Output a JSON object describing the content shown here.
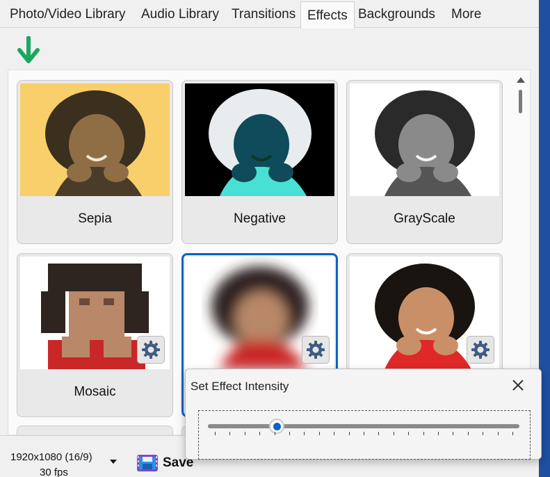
{
  "tabs": [
    {
      "label": "Photo/Video Library",
      "active": false
    },
    {
      "label": "Audio Library",
      "active": false
    },
    {
      "label": "Transitions",
      "active": false
    },
    {
      "label": "Effects",
      "active": true
    },
    {
      "label": "Backgrounds",
      "active": false
    },
    {
      "label": "More",
      "active": false
    }
  ],
  "toolbar": {
    "download_icon": "arrow-down-icon",
    "accent": "#1aa860"
  },
  "effects": [
    {
      "label": "Sepia",
      "style": "sepia",
      "has_settings": false,
      "selected": false
    },
    {
      "label": "Negative",
      "style": "negative",
      "has_settings": false,
      "selected": false
    },
    {
      "label": "GrayScale",
      "style": "grayscale",
      "has_settings": false,
      "selected": false
    },
    {
      "label": "Mosaic",
      "style": "mosaic",
      "has_settings": true,
      "selected": false
    },
    {
      "label": "",
      "style": "blur",
      "has_settings": true,
      "selected": true
    },
    {
      "label": "",
      "style": "cartoon",
      "has_settings": true,
      "selected": false
    }
  ],
  "bottom_bar": {
    "resolution": "1920x1080 (16/9)",
    "fps": "30 fps",
    "save_label": "Save"
  },
  "intensity_popup": {
    "title": "Set Effect Intensity",
    "close_icon": "close-icon",
    "intensity": 0.22,
    "tick_count": 21
  },
  "colors": {
    "selection": "#0a64c6",
    "accent_edge": "#1f4fa0"
  }
}
